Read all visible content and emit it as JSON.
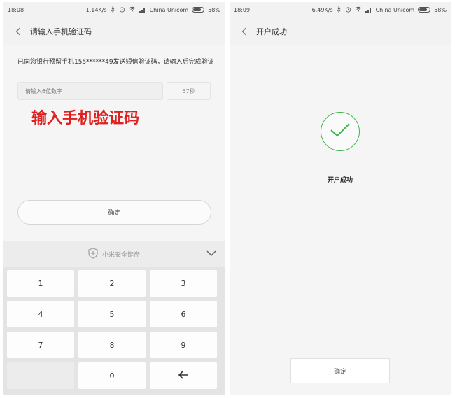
{
  "left": {
    "status": {
      "time": "18:08",
      "speed": "1.14K/s",
      "carrier": "China Unicom",
      "battery": "58%"
    },
    "title": "请输入手机验证码",
    "message": "已向您银行预留手机155******49发送短信验证码，请输入后完成验证",
    "code_input": {
      "placeholder": "请输入6位数字",
      "value": ""
    },
    "countdown": "57秒",
    "annotation": "输入手机验证码",
    "confirm_label": "确定",
    "keyboard": {
      "title": "小米安全键盘",
      "keys": [
        "1",
        "2",
        "3",
        "4",
        "5",
        "6",
        "7",
        "8",
        "9",
        "",
        "0",
        "←"
      ]
    }
  },
  "right": {
    "status": {
      "time": "18:09",
      "speed": "6.49K/s",
      "carrier": "China Unicom",
      "battery": "58%"
    },
    "title": "开户成功",
    "success_text": "开户成功",
    "confirm_label": "确定"
  },
  "colors": {
    "success_green": "#3db54a",
    "annotation_red": "#e02020"
  },
  "icons": [
    "back-icon",
    "bluetooth-icon",
    "alarm-icon",
    "wifi-icon",
    "signal-icon",
    "battery-icon",
    "shield-icon",
    "chevron-down-icon",
    "backspace-icon",
    "checkmark-icon"
  ]
}
